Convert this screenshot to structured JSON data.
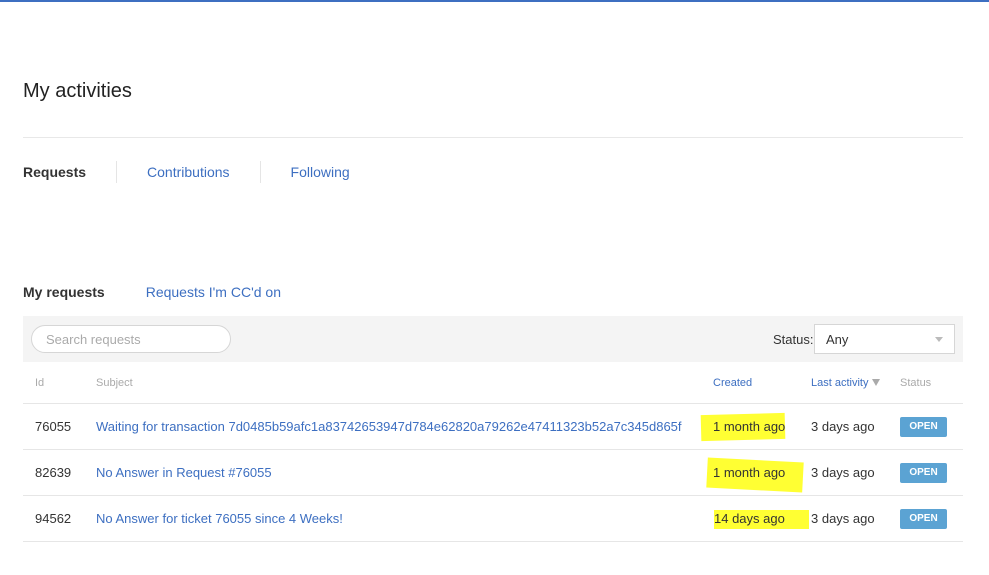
{
  "page": {
    "title": "My activities"
  },
  "nav": {
    "tabs": [
      {
        "label": "Requests"
      },
      {
        "label": "Contributions"
      },
      {
        "label": "Following"
      }
    ]
  },
  "subnav": {
    "tabs": [
      {
        "label": "My requests"
      },
      {
        "label": "Requests I'm CC'd on"
      }
    ]
  },
  "toolbar": {
    "search_placeholder": "Search requests",
    "status_label": "Status:",
    "status_value": "Any"
  },
  "table": {
    "headers": {
      "id": "Id",
      "subject": "Subject",
      "created": "Created",
      "last_activity": "Last activity",
      "status": "Status"
    },
    "rows": [
      {
        "id": "76055",
        "subject": "Waiting for transaction 7d0485b59afc1a83742653947d784e62820a79262e47411323b52a7c345d865f",
        "created": "1 month ago",
        "last_activity": "3 days ago",
        "status": "OPEN"
      },
      {
        "id": "82639",
        "subject": "No Answer in Request #76055",
        "created": "1 month ago",
        "last_activity": "3 days ago",
        "status": "OPEN"
      },
      {
        "id": "94562",
        "subject": "No Answer for ticket 76055 since 4 Weeks!",
        "created": "14 days ago",
        "last_activity": "3 days ago",
        "status": "OPEN"
      }
    ]
  },
  "colors": {
    "accent": "#3d6fc1",
    "highlight": "#ffff33",
    "status_open": "#5ba3d3"
  }
}
